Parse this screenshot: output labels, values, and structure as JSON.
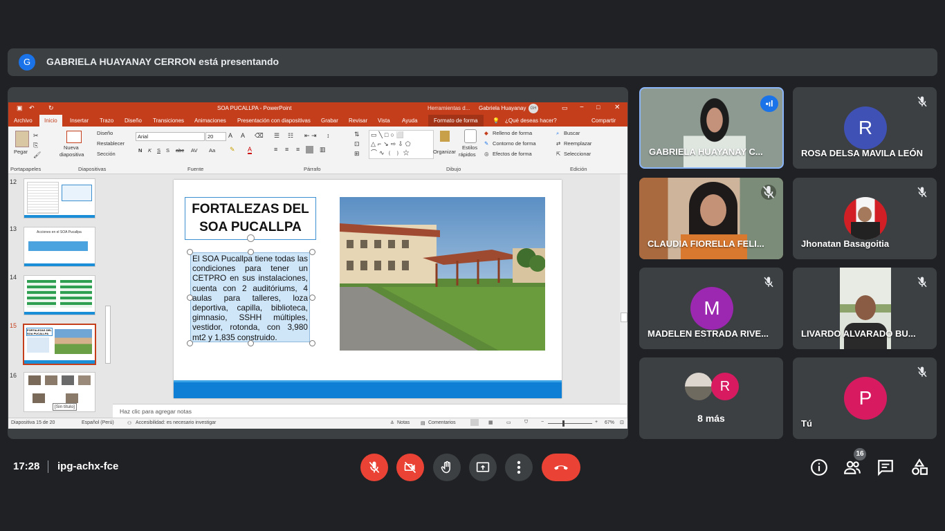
{
  "banner": {
    "avatar_letter": "G",
    "text": "GABRIELA HUAYANAY CERRON está presentando"
  },
  "ppt": {
    "title": "SOA PUCALLPA - PowerPoint",
    "tools": "Herramientas d...",
    "user": "Gabriela Huayanay",
    "user_initials": "GH",
    "tabs": [
      "Archivo",
      "Inicio",
      "Insertar",
      "Trazo",
      "Diseño",
      "Transiciones",
      "Animaciones",
      "Presentación con diapositivas",
      "Grabar",
      "Revisar",
      "Vista",
      "Ayuda",
      "Formato de forma"
    ],
    "tell_me": "¿Qué deseas hacer?",
    "share": "Compartir",
    "ribbon": {
      "paste": "Pegar",
      "new_slide_1": "Nueva",
      "new_slide_2": "diapositiva",
      "layout": "Diseño",
      "reset": "Restablecer",
      "section": "Sección",
      "font": "Arial",
      "size": "20",
      "organize": "Organizar",
      "styles_1": "Estilos",
      "styles_2": "rápidos",
      "fill": "Relleno de forma",
      "outline": "Contorno de forma",
      "effects": "Efectos de forma",
      "find": "Buscar",
      "replace": "Reemplazar",
      "select": "Seleccionar",
      "groups": [
        "Portapapeles",
        "Diapositivas",
        "Fuente",
        "Párrafo",
        "Dibujo",
        "Edición"
      ]
    },
    "thumbs": [
      {
        "num": "12"
      },
      {
        "num": "13",
        "text": "Acciones en el SOA Pucallpa"
      },
      {
        "num": "14"
      },
      {
        "num": "15",
        "text": "FORTALEZAS DEL SOA PUCALLPA"
      },
      {
        "num": "16"
      }
    ],
    "tooltip": "[Sin título]",
    "slide": {
      "title_line1": "FORTALEZAS DEL",
      "title_line2": "SOA PUCALLPA",
      "body": "El SOA Pucallpa tiene todas las condiciones para tener un CETPRO en sus instalaciones, cuenta con 2 auditóriums, 4 aulas para talleres, loza deportiva, capilla, biblioteca, gimnasio, SSHH múltiples, vestidor, rotonda, con 3,980 mt2 y 1,835 construido."
    },
    "notes": "Haz clic para agregar notas",
    "status": {
      "slide": "Diapositiva 15 de 20",
      "lang": "Español (Perú)",
      "access": "Accesibilidad: es necesario investigar",
      "notes": "Notas",
      "comments": "Comentarios",
      "zoom": "67%"
    }
  },
  "participants": [
    {
      "name": "GABRIELA HUAYANAY C...",
      "speaking": true
    },
    {
      "name": "ROSA DELSA MAVILA LEÓN",
      "letter": "R",
      "color": "#3f51b5"
    },
    {
      "name": "CLAUDIA FIORELLA FELI..."
    },
    {
      "name": "Jhonatan Basagoitia"
    },
    {
      "name": "MADELEN ESTRADA RIVE...",
      "letter": "M",
      "color": "#9c27b0"
    },
    {
      "name": "LIVARDO ALVARADO BU..."
    },
    {
      "more": "8 más",
      "letter": "R",
      "color": "#d81b60"
    },
    {
      "name": "Tú",
      "letter": "P",
      "color": "#d81b60"
    }
  ],
  "meeting": {
    "time": "17:28",
    "code": "ipg-achx-fce",
    "people_count": "16"
  },
  "colors": {
    "accent": "#8ab4f8",
    "danger": "#ea4335",
    "ppt": "#c43e1c"
  }
}
